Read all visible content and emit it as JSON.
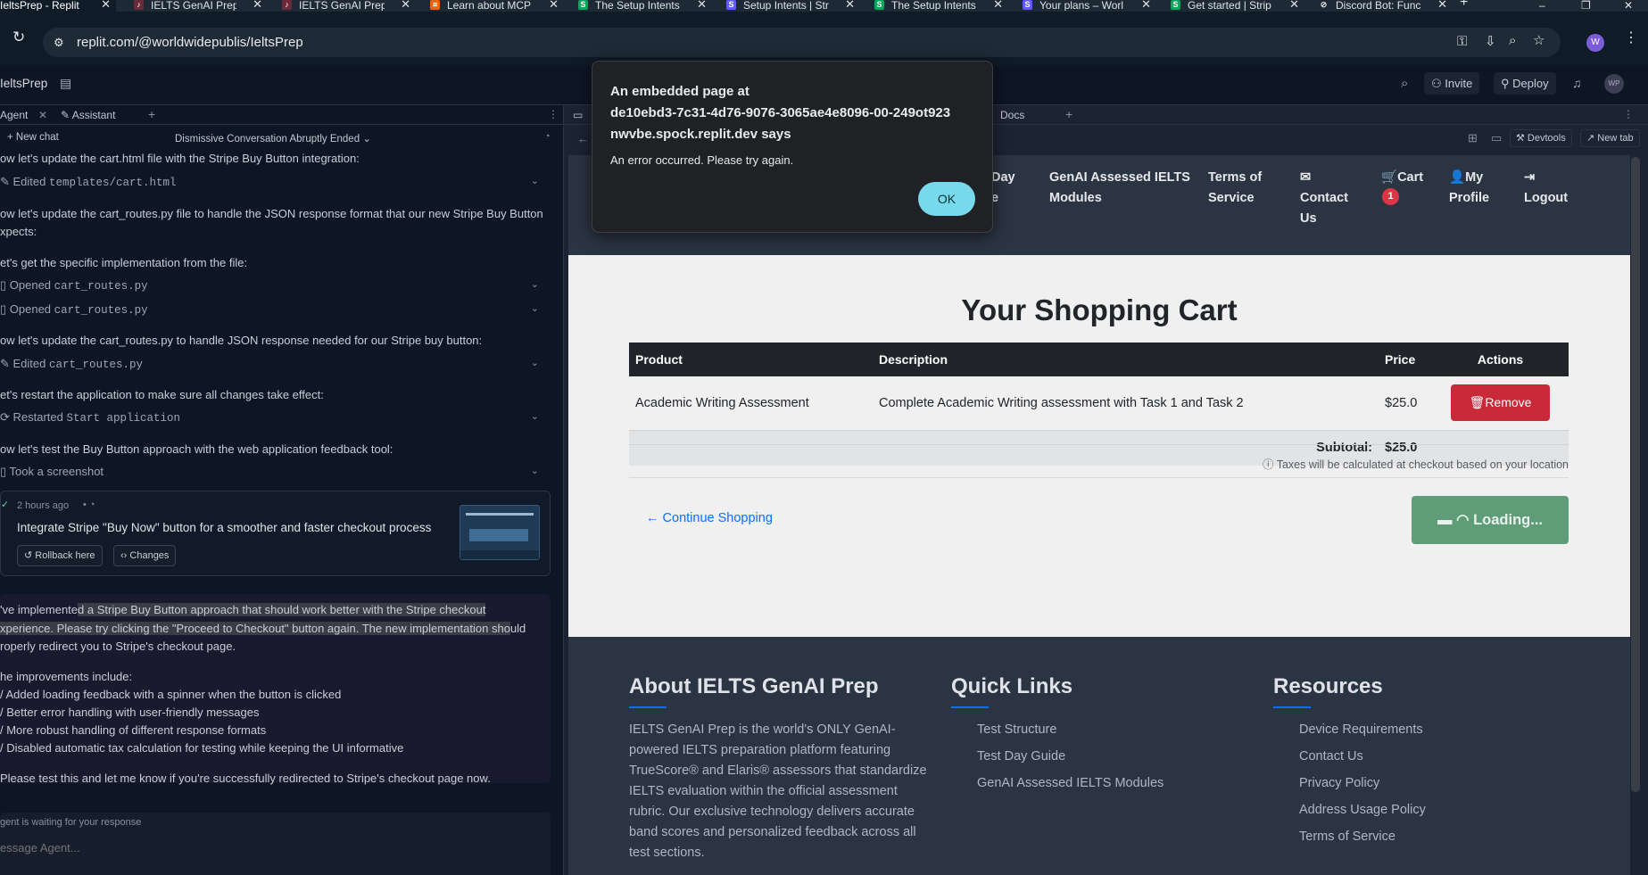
{
  "browser": {
    "tabs": [
      {
        "label": "IeltsPrep - Replit",
        "active": true,
        "favicon": "replit"
      },
      {
        "label": "IELTS GenAI Prep",
        "favicon": "ielts"
      },
      {
        "label": "IELTS GenAI Prep",
        "favicon": "ielts"
      },
      {
        "label": "Learn about MCP",
        "favicon": "replit-orange"
      },
      {
        "label": "The Setup Intents",
        "favicon": "stripe-green"
      },
      {
        "label": "Setup Intents | Stri",
        "favicon": "stripe-purple"
      },
      {
        "label": "The Setup Intents",
        "favicon": "stripe-green"
      },
      {
        "label": "Your plans – Worl",
        "favicon": "stripe-purple"
      },
      {
        "label": "Get started | Strip",
        "favicon": "stripe-green"
      },
      {
        "label": "Discord Bot: Func",
        "favicon": "discord"
      }
    ],
    "url": "replit.com/@worldwidepublis/IeltsPrep",
    "profile_initial": "W"
  },
  "replit": {
    "project_name": "IeltsPrep",
    "invite_label": "Invite",
    "deploy_label": "Deploy",
    "avatar": "WP",
    "left_tabs": [
      "Agent",
      "Assistant"
    ],
    "right_tabs": [
      "Docs"
    ],
    "new_chat": "New chat",
    "conversation_title": "Dismissive Conversation Abruptly Ended",
    "devtools": "Devtools",
    "newtab": "New tab"
  },
  "chat": {
    "lines": [
      {
        "kind": "msg",
        "text": "ow let's update the cart.html file with the Stripe Buy Button integration:"
      },
      {
        "kind": "tool",
        "action": "Edited",
        "target": "templates/cart.html"
      },
      {
        "kind": "msg",
        "text": "ow let's update the cart_routes.py file to handle the JSON response format that our new Stripe Buy Button"
      },
      {
        "kind": "msg2",
        "text": "xpects:"
      },
      {
        "kind": "msg",
        "text": "et's get the specific implementation from the file:"
      },
      {
        "kind": "tool",
        "action": "Opened",
        "target": "cart_routes.py"
      },
      {
        "kind": "tool",
        "action": "Opened",
        "target": "cart_routes.py"
      },
      {
        "kind": "msg",
        "text": "ow let's update the cart_routes.py to handle JSON response needed for our Stripe buy button:"
      },
      {
        "kind": "tool",
        "action": "Edited",
        "target": "cart_routes.py"
      },
      {
        "kind": "msg",
        "text": "et's restart the application to make sure all changes take effect:"
      },
      {
        "kind": "tool",
        "action": "Restarted",
        "target": "Start application"
      },
      {
        "kind": "msg",
        "text": "ow let's test the Buy Button approach with the web application feedback tool:"
      },
      {
        "kind": "tool",
        "action": "Took a screenshot",
        "target": ""
      }
    ],
    "checkpoint": {
      "time": "2 hours ago",
      "title": "Integrate Stripe \"Buy Now\" button for a smoother and faster checkout process",
      "rollback": "Rollback here",
      "changes": "Changes"
    },
    "reply": {
      "p1a": "'ve implemente",
      "p1b": "d a Stripe Buy Button approach that should work better with the Stripe checkout",
      "p1c": "xperience. Please try clicking the \"Proceed to Checkout\" button again. The new implementation sho",
      "p1d": "uld",
      "p1e": "roperly redirect you to Stripe's checkout page.",
      "p2": "he improvements include:",
      "bullets": [
        "/ Added loading feedback with a spinner when the button is clicked",
        "/ Better error handling with user-friendly messages",
        "/ More robust handling of different response formats",
        "/ Disabled automatic tax calculation for testing while keeping the UI informative"
      ],
      "p3": "Please test this and let me know if you're successfully redirected to Stripe's checkout page now."
    },
    "waiting": "gent is waiting for your response",
    "input_placeholder": "essage Agent..."
  },
  "site": {
    "nav": [
      {
        "l1": "Day",
        "l2": "e"
      },
      {
        "l1": "GenAI Assessed IELTS",
        "l2": "Modules"
      },
      {
        "l1": "Terms of",
        "l2": "Service"
      },
      {
        "l1": "Contact",
        "l2": "Us"
      },
      {
        "l1": "Cart",
        "badge": "1"
      },
      {
        "l1": "My",
        "l2": "Profile"
      },
      {
        "l1": "Logout"
      }
    ],
    "cart_title": "Your Shopping Cart",
    "columns": [
      "Product",
      "Description",
      "Price",
      "Actions"
    ],
    "rows": [
      {
        "product": "Academic Writing Assessment",
        "description": "Complete Academic Writing assessment with Task 1 and Task 2",
        "price": "$25.0",
        "action": "Remove"
      }
    ],
    "subtotal_label": "Subtotal:",
    "subtotal_value": "$25.0",
    "tax_note": "Taxes will be calculated at checkout based on your location",
    "continue": "Continue Shopping",
    "loading": "Loading...",
    "footer": {
      "about_title": "About IELTS GenAI Prep",
      "about_lines": [
        "IELTS GenAI Prep is the world's ONLY GenAI-",
        "powered IELTS preparation platform featuring",
        "TrueScore® and Elaris® assessors that standardize",
        "IELTS evaluation within the official assessment",
        "rubric. Our exclusive technology delivers accurate",
        "band scores and personalized feedback across all",
        "test sections."
      ],
      "quick_title": "Quick Links",
      "quick_links": [
        "Test Structure",
        "Test Day Guide",
        "GenAI Assessed IELTS Modules"
      ],
      "res_title": "Resources",
      "res_links": [
        "Device Requirements",
        "Contact Us",
        "Privacy Policy",
        "Address Usage Policy",
        "Terms of Service"
      ]
    }
  },
  "dialog": {
    "heading1": "An embedded page at",
    "heading2": "de10ebd3-7c31-4d76-9076-3065ae4e8096-00-249ot923",
    "heading3": "nwvbe.spock.replit.dev says",
    "message": "An error occurred. Please try again.",
    "ok": "OK"
  },
  "colors": {
    "accent": "#0d6efd",
    "danger": "#dc3545",
    "success": "#198754",
    "dialog_ok": "#78d9ec"
  }
}
